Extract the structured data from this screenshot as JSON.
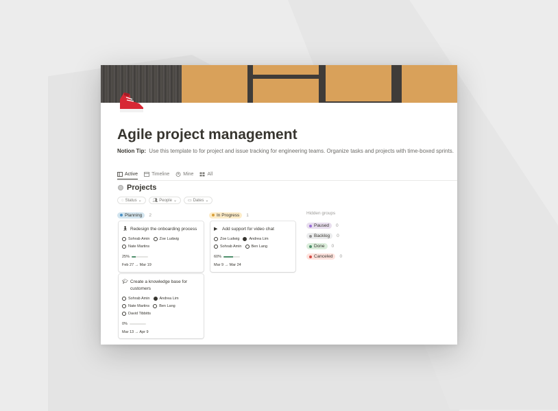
{
  "page": {
    "title": "Agile project management",
    "tip_label": "Notion Tip:",
    "tip_text": "Use this template to for project and issue tracking for engineering teams. Organize tasks and projects with time-boxed sprints.",
    "icon": "sneaker-icon"
  },
  "tabs": [
    {
      "label": "Active",
      "icon": "board-icon",
      "active": true
    },
    {
      "label": "Timeline",
      "icon": "timeline-icon",
      "active": false
    },
    {
      "label": "Mine",
      "icon": "person-icon",
      "active": false
    },
    {
      "label": "All",
      "icon": "grid-icon",
      "active": false
    }
  ],
  "database": {
    "title": "Projects"
  },
  "filters": [
    {
      "label": "Status",
      "icon": "status-icon"
    },
    {
      "label": "People",
      "icon": "people-icon"
    },
    {
      "label": "Dates",
      "icon": "calendar-icon"
    }
  ],
  "groups": [
    {
      "label": "Planning",
      "count": "2",
      "color": "#d3e5ef",
      "dot": "#4b91c6",
      "cards": [
        {
          "title": "Redesign the onboarding process",
          "emoji": "walking-person-icon",
          "people_row1": [
            "Sohrab Amin",
            "Zoe Ludwig"
          ],
          "people_row2": [
            "Nate Martins"
          ],
          "progress": "25%",
          "progress_value": 0.25,
          "dates": "Feb 27 → Mar 19"
        },
        {
          "title": "Create a knowledge base for customers",
          "emoji": "graduation-cap-icon",
          "people_row1": [
            "Sohrab Amin",
            "Andrea Lim"
          ],
          "people_row2": [
            "Nate Martins",
            "Ben Lang"
          ],
          "people_row3": [
            "David Tibbitts"
          ],
          "progress": "0%",
          "progress_value": 0,
          "dates": "Mar 13 → Apr 9"
        }
      ]
    },
    {
      "label": "In Progress",
      "count": "1",
      "color": "#fdecc8",
      "dot": "#d9a03a",
      "cards": [
        {
          "title": "Add support for video chat",
          "emoji": "video-camera-icon",
          "people_row1": [
            "Zoe Ludwig",
            "Andrea Lim"
          ],
          "people_row2": [
            "Sohrab Amin",
            "Ben Lang"
          ],
          "progress": "60%",
          "progress_value": 0.6,
          "dates": "Mar 9 → Mar 24"
        }
      ]
    }
  ],
  "hidden": {
    "title": "Hidden groups",
    "items": [
      {
        "label": "Paused",
        "count": "0",
        "color": "#e8deee",
        "dot": "#9a6dd7"
      },
      {
        "label": "Backlog",
        "count": "0",
        "color": "#ebeced",
        "dot": "#8f8f8f"
      },
      {
        "label": "Done",
        "count": "0",
        "color": "#dbeddb",
        "dot": "#4e8f6b"
      },
      {
        "label": "Canceled",
        "count": "0",
        "color": "#ffe2dd",
        "dot": "#d44c47"
      }
    ]
  }
}
